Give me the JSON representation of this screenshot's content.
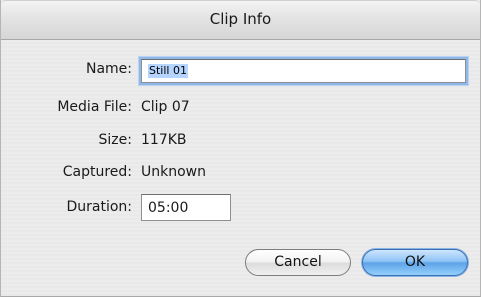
{
  "window": {
    "title": "Clip Info"
  },
  "fields": {
    "name": {
      "label": "Name:",
      "value": "Still 01"
    },
    "media_file": {
      "label": "Media File:",
      "value": "Clip 07"
    },
    "size": {
      "label": "Size:",
      "value": "117KB"
    },
    "captured": {
      "label": "Captured:",
      "value": "Unknown"
    },
    "duration": {
      "label": "Duration:",
      "value": "05:00"
    }
  },
  "buttons": {
    "cancel": "Cancel",
    "ok": "OK"
  },
  "colors": {
    "default_button": "#5ea3e8",
    "focus_ring": "#8fb7e8",
    "text_selection": "#b5d5ff"
  }
}
